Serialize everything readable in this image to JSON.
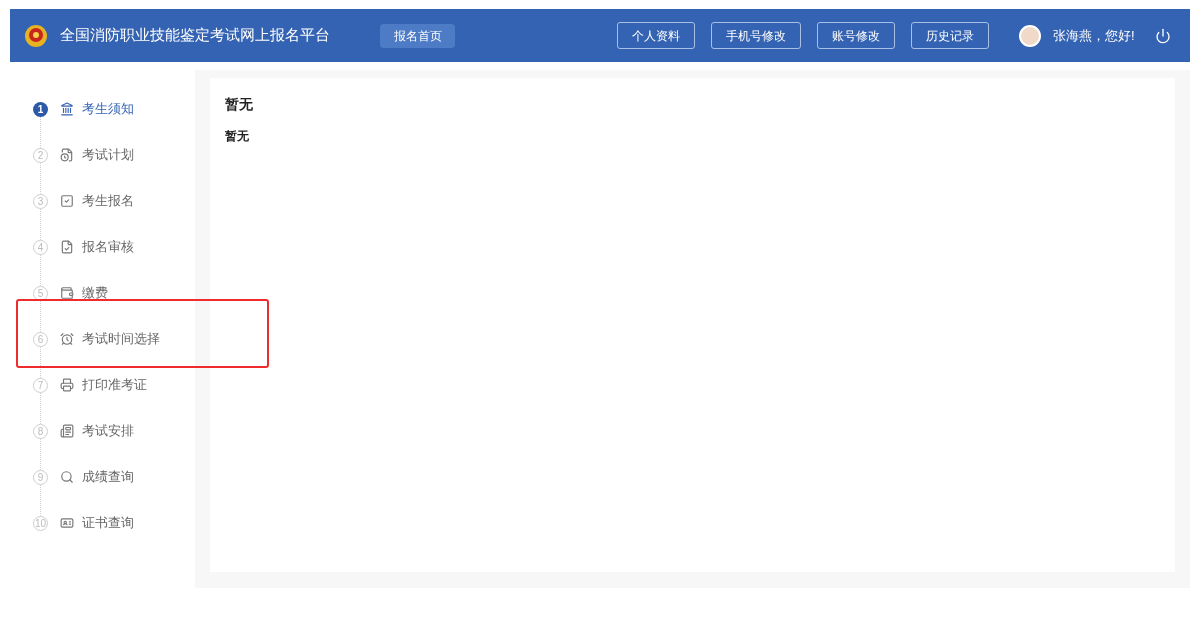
{
  "header": {
    "title": "全国消防职业技能鉴定考试网上报名平台",
    "home_button": "报名首页",
    "buttons": [
      "个人资料",
      "手机号修改",
      "账号修改",
      "历史记录"
    ],
    "greeting": "张海燕，您好!"
  },
  "steps": [
    {
      "number": "1",
      "label": "考生须知",
      "selected": true,
      "highlighted": false
    },
    {
      "number": "2",
      "label": "考试计划",
      "selected": false,
      "highlighted": false
    },
    {
      "number": "3",
      "label": "考生报名",
      "selected": false,
      "highlighted": false
    },
    {
      "number": "4",
      "label": "报名审核",
      "selected": false,
      "highlighted": false
    },
    {
      "number": "5",
      "label": "缴费",
      "selected": false,
      "highlighted": false
    },
    {
      "number": "6",
      "label": "考试时间选择",
      "selected": false,
      "highlighted": true
    },
    {
      "number": "7",
      "label": "打印准考证",
      "selected": false,
      "highlighted": false
    },
    {
      "number": "8",
      "label": "考试安排",
      "selected": false,
      "highlighted": false
    },
    {
      "number": "9",
      "label": "成绩查询",
      "selected": false,
      "highlighted": false
    },
    {
      "number": "10",
      "label": "证书查询",
      "selected": false,
      "highlighted": false
    }
  ],
  "content": {
    "title": "暂无",
    "body": "暂无"
  }
}
